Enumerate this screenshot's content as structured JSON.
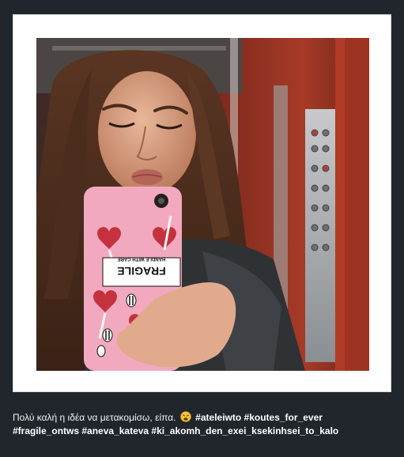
{
  "post": {
    "caption_text": "Πολύ καλή η ιδέα να μετακομίσω, είπα.",
    "emoji_icon": "weary-face-icon",
    "hashtags_line1": "#ateleiwto #koutes_for_ever",
    "hashtags_line2": "#fragile_ontws #aneva_kateva #ki_akomh_den_exei_ksekinhsei_to_kalo"
  },
  "phone_case": {
    "sticker_title": "FRAGILE",
    "sticker_subtitle": "HANDLE WITH CARE"
  },
  "colors": {
    "page_background": "#20262c",
    "card_background": "#ffffff",
    "phone_case_pink": "#f2a9bf",
    "elevator_red": "#8e2c1f"
  }
}
